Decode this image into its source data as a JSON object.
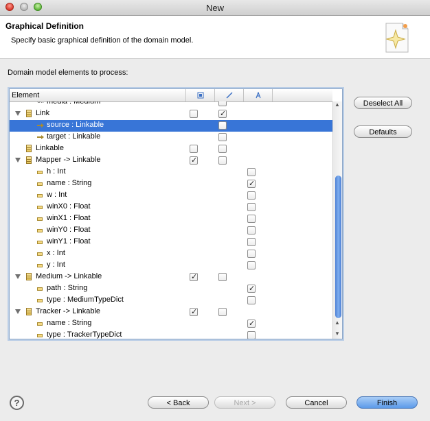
{
  "window": {
    "title": "New"
  },
  "header": {
    "title": "Graphical Definition",
    "description": "Specify basic graphical definition of the domain model."
  },
  "section_label": "Domain model elements to process:",
  "tree": {
    "columns": [
      "Element",
      "node-column-icon",
      "link-column-icon",
      "label-column-icon"
    ],
    "rows": [
      {
        "label": "media : Medium",
        "icon": "many-ref-icon",
        "indent": 2,
        "expand": "none",
        "c1": null,
        "c2": false,
        "c3": null,
        "sel": false
      },
      {
        "label": "Link",
        "icon": "class-icon",
        "indent": 1,
        "expand": "open",
        "c1": false,
        "c2": true,
        "c3": null,
        "sel": false
      },
      {
        "label": "source : Linkable",
        "icon": "reference-icon",
        "indent": 2,
        "expand": "none",
        "c1": null,
        "c2": false,
        "c3": null,
        "sel": true
      },
      {
        "label": "target : Linkable",
        "icon": "reference-icon",
        "indent": 2,
        "expand": "none",
        "c1": null,
        "c2": false,
        "c3": null,
        "sel": false
      },
      {
        "label": "Linkable",
        "icon": "class-icon",
        "indent": 1,
        "expand": "none",
        "c1": false,
        "c2": false,
        "c3": null,
        "sel": false
      },
      {
        "label": "Mapper -> Linkable",
        "icon": "class-icon",
        "indent": 1,
        "expand": "open",
        "c1": true,
        "c2": false,
        "c3": null,
        "sel": false
      },
      {
        "label": "h : Int",
        "icon": "attribute-icon",
        "indent": 2,
        "expand": "none",
        "c1": null,
        "c2": null,
        "c3": false,
        "sel": false
      },
      {
        "label": "name : String",
        "icon": "attribute-icon",
        "indent": 2,
        "expand": "none",
        "c1": null,
        "c2": null,
        "c3": true,
        "sel": false
      },
      {
        "label": "w : Int",
        "icon": "attribute-icon",
        "indent": 2,
        "expand": "none",
        "c1": null,
        "c2": null,
        "c3": false,
        "sel": false
      },
      {
        "label": "winX0 : Float",
        "icon": "attribute-icon",
        "indent": 2,
        "expand": "none",
        "c1": null,
        "c2": null,
        "c3": false,
        "sel": false
      },
      {
        "label": "winX1 : Float",
        "icon": "attribute-icon",
        "indent": 2,
        "expand": "none",
        "c1": null,
        "c2": null,
        "c3": false,
        "sel": false
      },
      {
        "label": "winY0 : Float",
        "icon": "attribute-icon",
        "indent": 2,
        "expand": "none",
        "c1": null,
        "c2": null,
        "c3": false,
        "sel": false
      },
      {
        "label": "winY1 : Float",
        "icon": "attribute-icon",
        "indent": 2,
        "expand": "none",
        "c1": null,
        "c2": null,
        "c3": false,
        "sel": false
      },
      {
        "label": "x : Int",
        "icon": "attribute-icon",
        "indent": 2,
        "expand": "none",
        "c1": null,
        "c2": null,
        "c3": false,
        "sel": false
      },
      {
        "label": "y : Int",
        "icon": "attribute-icon",
        "indent": 2,
        "expand": "none",
        "c1": null,
        "c2": null,
        "c3": false,
        "sel": false
      },
      {
        "label": "Medium -> Linkable",
        "icon": "class-icon",
        "indent": 1,
        "expand": "open",
        "c1": true,
        "c2": false,
        "c3": null,
        "sel": false
      },
      {
        "label": "path : String",
        "icon": "attribute-icon",
        "indent": 2,
        "expand": "none",
        "c1": null,
        "c2": null,
        "c3": true,
        "sel": false
      },
      {
        "label": "type : MediumTypeDict",
        "icon": "attribute-icon",
        "indent": 2,
        "expand": "none",
        "c1": null,
        "c2": null,
        "c3": false,
        "sel": false
      },
      {
        "label": "Tracker -> Linkable",
        "icon": "class-icon",
        "indent": 1,
        "expand": "open",
        "c1": true,
        "c2": false,
        "c3": null,
        "sel": false
      },
      {
        "label": "name : String",
        "icon": "attribute-icon",
        "indent": 2,
        "expand": "none",
        "c1": null,
        "c2": null,
        "c3": true,
        "sel": false
      },
      {
        "label": "type : TrackerTypeDict",
        "icon": "attribute-icon",
        "indent": 2,
        "expand": "none",
        "c1": null,
        "c2": null,
        "c3": false,
        "sel": false
      }
    ]
  },
  "side_buttons": {
    "deselect_all": "Deselect All",
    "defaults": "Defaults"
  },
  "footer": {
    "back": "< Back",
    "next": "Next >",
    "cancel": "Cancel",
    "finish": "Finish"
  },
  "colors": {
    "selection": "#3875d7",
    "default_button": "#5c9ae9"
  }
}
